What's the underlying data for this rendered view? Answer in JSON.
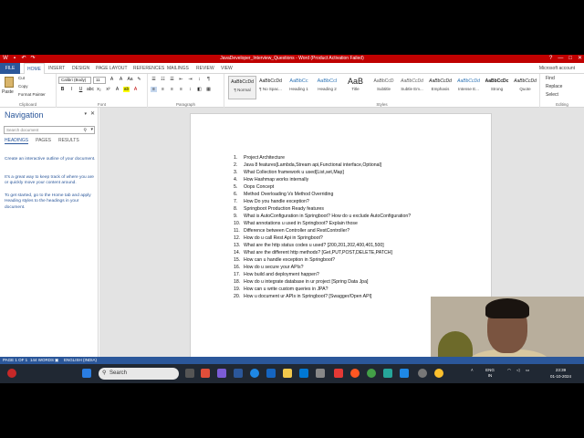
{
  "window": {
    "title": "JavaDeveloper_Interview_Questions - Word (Product Activation Failed)",
    "controls": [
      "?",
      "—",
      "□",
      "✕"
    ]
  },
  "tabs": {
    "file": "FILE",
    "items": [
      "HOME",
      "INSERT",
      "DESIGN",
      "PAGE LAYOUT",
      "REFERENCES",
      "MAILINGS",
      "REVIEW",
      "VIEW"
    ],
    "active": "HOME",
    "account": "Microsoft account"
  },
  "ribbon": {
    "clipboard": {
      "paste": "Paste",
      "cut": "Cut",
      "copy": "Copy",
      "format_painter": "Format Painter",
      "label": "Clipboard"
    },
    "font": {
      "name": "Calibri (Body)",
      "size": "11",
      "label": "Font"
    },
    "paragraph": {
      "label": "Paragraph"
    },
    "styles": {
      "label": "Styles",
      "items": [
        {
          "preview": "AaBbCcDd",
          "name": "¶ Normal"
        },
        {
          "preview": "AaBbCcDd",
          "name": "¶ No Spac..."
        },
        {
          "preview": "AaBbCc",
          "name": "Heading 1"
        },
        {
          "preview": "AaBbCcI",
          "name": "Heading 2"
        },
        {
          "preview": "AaB",
          "name": "Title"
        },
        {
          "preview": "AaBbCcD",
          "name": "Subtitle"
        },
        {
          "preview": "AaBbCcDd",
          "name": "Subtle Em..."
        },
        {
          "preview": "AaBbCcDd",
          "name": "Emphasis"
        },
        {
          "preview": "AaBbCcDd",
          "name": "Intense E..."
        },
        {
          "preview": "AaBbCcDc",
          "name": "Strong"
        },
        {
          "preview": "AaBbCcDd",
          "name": "Quote"
        }
      ]
    },
    "editing": {
      "find": "Find",
      "replace": "Replace",
      "select": "Select",
      "label": "Editing"
    }
  },
  "navigation": {
    "title": "Navigation",
    "search_placeholder": "Search document",
    "tabs": [
      "HEADINGS",
      "PAGES",
      "RESULTS"
    ],
    "text1": "Create an interactive outline of your document.",
    "text2": "It's a great way to keep track of where you are or quickly move your content around.",
    "text3": "To get started, go to the Home tab and apply Heading styles to the headings in your document."
  },
  "document": {
    "items": [
      "Project Architecture",
      "Java 8 features[Lambda,Stream api,Functional interface,Optional]",
      "What Collection framework u used[List,set,Map]",
      "How Hashmap works internally",
      "Oops Concept",
      "Method Overloading Vs Method Overriding",
      "How Do you handle exception?",
      "Springboot Production Ready features",
      "What is AutoConfiguration in Springboot? How do u exclude AutoConfiguration?",
      "What annotations u used in Springboot? Explain those",
      "Difference between Controller and RestController?",
      "How do u call Rest Api in Springboot?",
      "What are the http status codes u used? [200,201,202,400,401,500]",
      "What are the different http methods? [Get,PUT,POST,DELETE,PATCH]",
      "How can u handle exception in Springboot?",
      "How do u secure your APIs?",
      "How build and deployment happen?",
      "How do u integrate database in ur project [Spring Data Jpa]",
      "How can u write custom queries in JPA?",
      "How u document ur APIs in Springboot? [Swagger/Open API]"
    ]
  },
  "statusbar": {
    "page": "PAGE 1 OF 1",
    "words": "144 WORDS",
    "language": "ENGLISH (INDIA)"
  },
  "taskbar": {
    "search": "Search",
    "language": "ENG",
    "region": "IN",
    "time": "23:39",
    "date": "01-10-2024"
  }
}
